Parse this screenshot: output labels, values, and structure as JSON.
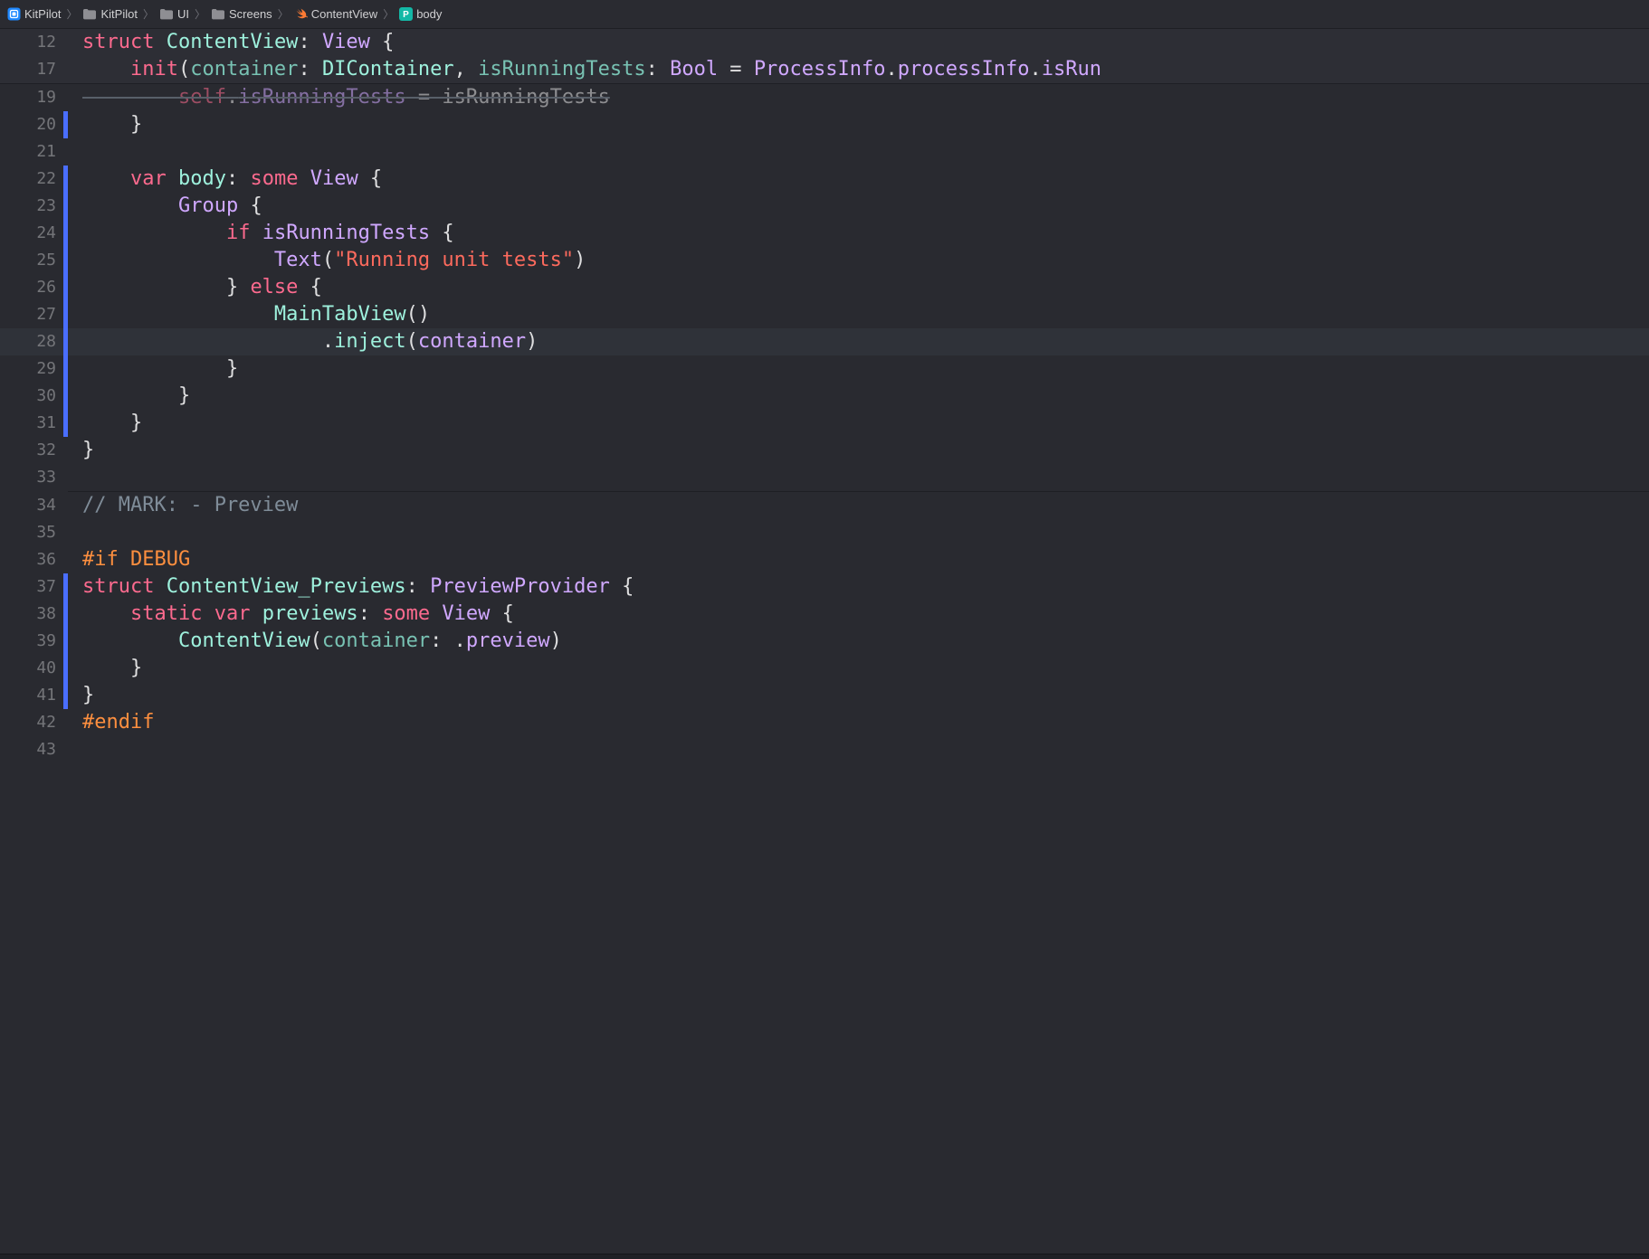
{
  "breadcrumb": [
    {
      "icon": "app",
      "label": "KitPilot"
    },
    {
      "icon": "folder",
      "label": "KitPilot"
    },
    {
      "icon": "folder",
      "label": "UI"
    },
    {
      "icon": "folder",
      "label": "Screens"
    },
    {
      "icon": "swift",
      "label": "ContentView"
    },
    {
      "icon": "prop",
      "label": "body"
    }
  ],
  "sticky": [
    {
      "num": "12",
      "tokens": [
        {
          "t": "kw",
          "v": "struct"
        },
        {
          "t": "plain",
          "v": " "
        },
        {
          "t": "tlib",
          "v": "ContentView"
        },
        {
          "t": "plain",
          "v": ": "
        },
        {
          "t": "type",
          "v": "View"
        },
        {
          "t": "plain",
          "v": " {"
        }
      ]
    },
    {
      "num": "17",
      "tokens": [
        {
          "t": "plain",
          "v": "    "
        },
        {
          "t": "kw",
          "v": "init"
        },
        {
          "t": "plain",
          "v": "("
        },
        {
          "t": "param",
          "v": "container"
        },
        {
          "t": "plain",
          "v": ": "
        },
        {
          "t": "tlib",
          "v": "DIContainer"
        },
        {
          "t": "plain",
          "v": ", "
        },
        {
          "t": "param",
          "v": "isRunningTests"
        },
        {
          "t": "plain",
          "v": ": "
        },
        {
          "t": "type",
          "v": "Bool"
        },
        {
          "t": "plain",
          "v": " = "
        },
        {
          "t": "type",
          "v": "ProcessInfo"
        },
        {
          "t": "plain",
          "v": "."
        },
        {
          "t": "type",
          "v": "processInfo"
        },
        {
          "t": "plain",
          "v": "."
        },
        {
          "t": "type",
          "v": "isRun"
        }
      ]
    }
  ],
  "lines": [
    {
      "num": "19",
      "faded": true,
      "strike": true,
      "tokens": [
        {
          "t": "plain",
          "v": "        "
        },
        {
          "t": "kw",
          "v": "self"
        },
        {
          "t": "plain",
          "v": "."
        },
        {
          "t": "type",
          "v": "isRunningTests"
        },
        {
          "t": "plain",
          "v": " = isRunningTests"
        }
      ]
    },
    {
      "num": "20",
      "mod": true,
      "tokens": [
        {
          "t": "plain",
          "v": "    }"
        }
      ]
    },
    {
      "num": "21",
      "tokens": [
        {
          "t": "plain",
          "v": ""
        }
      ]
    },
    {
      "num": "22",
      "mod": true,
      "tokens": [
        {
          "t": "plain",
          "v": "    "
        },
        {
          "t": "kw",
          "v": "var"
        },
        {
          "t": "plain",
          "v": " "
        },
        {
          "t": "tlib",
          "v": "body"
        },
        {
          "t": "plain",
          "v": ": "
        },
        {
          "t": "kw",
          "v": "some"
        },
        {
          "t": "plain",
          "v": " "
        },
        {
          "t": "type",
          "v": "View"
        },
        {
          "t": "plain",
          "v": " {"
        }
      ]
    },
    {
      "num": "23",
      "mod": true,
      "tokens": [
        {
          "t": "plain",
          "v": "        "
        },
        {
          "t": "type",
          "v": "Group"
        },
        {
          "t": "plain",
          "v": " {"
        }
      ]
    },
    {
      "num": "24",
      "mod": true,
      "tokens": [
        {
          "t": "plain",
          "v": "            "
        },
        {
          "t": "kw",
          "v": "if"
        },
        {
          "t": "plain",
          "v": " "
        },
        {
          "t": "type",
          "v": "isRunningTests"
        },
        {
          "t": "plain",
          "v": " {"
        }
      ]
    },
    {
      "num": "25",
      "mod": true,
      "tokens": [
        {
          "t": "plain",
          "v": "                "
        },
        {
          "t": "type",
          "v": "Text"
        },
        {
          "t": "plain",
          "v": "("
        },
        {
          "t": "str",
          "v": "\"Running unit tests\""
        },
        {
          "t": "plain",
          "v": ")"
        }
      ]
    },
    {
      "num": "26",
      "mod": true,
      "tokens": [
        {
          "t": "plain",
          "v": "            } "
        },
        {
          "t": "kw",
          "v": "else"
        },
        {
          "t": "plain",
          "v": " {"
        }
      ]
    },
    {
      "num": "27",
      "mod": true,
      "tokens": [
        {
          "t": "plain",
          "v": "                "
        },
        {
          "t": "tlib",
          "v": "MainTabView"
        },
        {
          "t": "plain",
          "v": "()"
        }
      ]
    },
    {
      "num": "28",
      "mod": true,
      "hl": true,
      "tokens": [
        {
          "t": "plain",
          "v": "                    ."
        },
        {
          "t": "tlib",
          "v": "inject"
        },
        {
          "t": "plain",
          "v": "("
        },
        {
          "t": "type",
          "v": "container"
        },
        {
          "t": "plain",
          "v": ")"
        }
      ]
    },
    {
      "num": "29",
      "mod": true,
      "tokens": [
        {
          "t": "plain",
          "v": "            }"
        }
      ]
    },
    {
      "num": "30",
      "mod": true,
      "tokens": [
        {
          "t": "plain",
          "v": "        }"
        }
      ]
    },
    {
      "num": "31",
      "mod": true,
      "tokens": [
        {
          "t": "plain",
          "v": "    }"
        }
      ]
    },
    {
      "num": "32",
      "tokens": [
        {
          "t": "plain",
          "v": "}"
        }
      ]
    },
    {
      "num": "33",
      "tokens": [
        {
          "t": "plain",
          "v": ""
        }
      ]
    },
    {
      "divider": true
    },
    {
      "num": "34",
      "tokens": [
        {
          "t": "cmt",
          "v": "// MARK: - Preview"
        }
      ]
    },
    {
      "num": "35",
      "tokens": [
        {
          "t": "plain",
          "v": ""
        }
      ]
    },
    {
      "num": "36",
      "tokens": [
        {
          "t": "pre",
          "v": "#if DEBUG"
        }
      ]
    },
    {
      "num": "37",
      "mod": true,
      "tokens": [
        {
          "t": "kw",
          "v": "struct"
        },
        {
          "t": "plain",
          "v": " "
        },
        {
          "t": "tlib",
          "v": "ContentView_Previews"
        },
        {
          "t": "plain",
          "v": ": "
        },
        {
          "t": "type",
          "v": "PreviewProvider"
        },
        {
          "t": "plain",
          "v": " {"
        }
      ]
    },
    {
      "num": "38",
      "mod": true,
      "tokens": [
        {
          "t": "plain",
          "v": "    "
        },
        {
          "t": "kw",
          "v": "static"
        },
        {
          "t": "plain",
          "v": " "
        },
        {
          "t": "kw",
          "v": "var"
        },
        {
          "t": "plain",
          "v": " "
        },
        {
          "t": "tlib",
          "v": "previews"
        },
        {
          "t": "plain",
          "v": ": "
        },
        {
          "t": "kw",
          "v": "some"
        },
        {
          "t": "plain",
          "v": " "
        },
        {
          "t": "type",
          "v": "View"
        },
        {
          "t": "plain",
          "v": " {"
        }
      ]
    },
    {
      "num": "39",
      "mod": true,
      "tokens": [
        {
          "t": "plain",
          "v": "        "
        },
        {
          "t": "tlib",
          "v": "ContentView"
        },
        {
          "t": "plain",
          "v": "("
        },
        {
          "t": "param",
          "v": "container"
        },
        {
          "t": "plain",
          "v": ": ."
        },
        {
          "t": "type",
          "v": "preview"
        },
        {
          "t": "plain",
          "v": ")"
        }
      ]
    },
    {
      "num": "40",
      "mod": true,
      "tokens": [
        {
          "t": "plain",
          "v": "    }"
        }
      ]
    },
    {
      "num": "41",
      "mod": true,
      "tokens": [
        {
          "t": "plain",
          "v": "}"
        }
      ]
    },
    {
      "num": "42",
      "tokens": [
        {
          "t": "pre",
          "v": "#endif"
        }
      ]
    },
    {
      "num": "43",
      "tokens": [
        {
          "t": "plain",
          "v": ""
        }
      ]
    }
  ]
}
